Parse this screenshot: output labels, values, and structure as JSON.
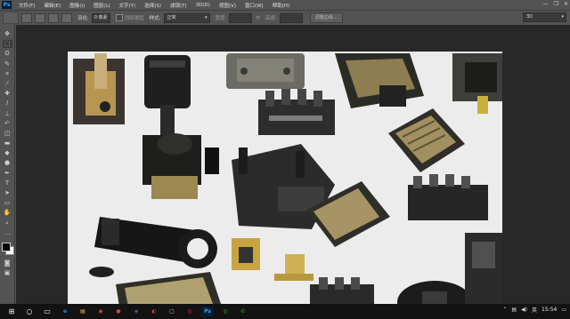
{
  "app": {
    "logo": "Ps"
  },
  "menu": {
    "items": [
      {
        "label": "文件(F)"
      },
      {
        "label": "编辑(E)"
      },
      {
        "label": "图像(I)"
      },
      {
        "label": "图层(L)"
      },
      {
        "label": "文字(Y)"
      },
      {
        "label": "选择(S)"
      },
      {
        "label": "滤镜(T)"
      },
      {
        "label": "3D(D)"
      },
      {
        "label": "视图(V)"
      },
      {
        "label": "窗口(W)"
      },
      {
        "label": "帮助(H)"
      }
    ],
    "window_controls": {
      "minimize": "—",
      "restore": "❐",
      "close": "✕"
    }
  },
  "options": {
    "feather_label": "羽化:",
    "feather_value": "0 像素",
    "antialias_label": "消除锯齿",
    "style_label": "样式:",
    "style_value": "正常",
    "width_label": "宽度:",
    "height_label": "高度:",
    "refine_edge_label": "调整边缘...",
    "workspace_value": "3D"
  },
  "tools": [
    {
      "icon": "move-icon",
      "glyph": "✥"
    },
    {
      "icon": "marquee-icon",
      "glyph": "⬚"
    },
    {
      "icon": "lasso-icon",
      "glyph": "ʘ"
    },
    {
      "icon": "quick-select-icon",
      "glyph": "✎"
    },
    {
      "icon": "crop-icon",
      "glyph": "⌗"
    },
    {
      "icon": "eyedropper-icon",
      "glyph": "⁄"
    },
    {
      "icon": "healing-icon",
      "glyph": "✚"
    },
    {
      "icon": "brush-icon",
      "glyph": "/"
    },
    {
      "icon": "stamp-icon",
      "glyph": "⊥"
    },
    {
      "icon": "history-brush-icon",
      "glyph": "↶"
    },
    {
      "icon": "eraser-icon",
      "glyph": "◫"
    },
    {
      "icon": "gradient-icon",
      "glyph": "▬"
    },
    {
      "icon": "blur-icon",
      "glyph": "◆"
    },
    {
      "icon": "dodge-icon",
      "glyph": "●"
    },
    {
      "icon": "pen-icon",
      "glyph": "✒"
    },
    {
      "icon": "type-icon",
      "glyph": "T"
    },
    {
      "icon": "path-select-icon",
      "glyph": "➤"
    },
    {
      "icon": "shape-icon",
      "glyph": "▭"
    },
    {
      "icon": "hand-icon",
      "glyph": "✋"
    },
    {
      "icon": "zoom-icon",
      "glyph": "⌕"
    },
    {
      "icon": "more-icon",
      "glyph": "…"
    }
  ],
  "bottom_tools": [
    {
      "icon": "quick-mask-icon",
      "glyph": "◙"
    },
    {
      "icon": "screen-mode-icon",
      "glyph": "▣"
    }
  ],
  "taskbar": {
    "start_glyph": "⊞",
    "search_glyph": "○",
    "taskview_glyph": "▭",
    "apps": [
      {
        "icon": "edge-icon",
        "glyph": "e",
        "color": "#1e90ff"
      },
      {
        "icon": "explorer-icon",
        "glyph": "▤",
        "color": "#f4c542"
      },
      {
        "icon": "app-icon-1",
        "glyph": "◉",
        "color": "#e34c26"
      },
      {
        "icon": "app-icon-2",
        "glyph": "●",
        "color": "#d04437"
      },
      {
        "icon": "app-icon-3",
        "glyph": "◈",
        "color": "#7a4fd8"
      },
      {
        "icon": "app-icon-4",
        "glyph": "◐",
        "color": "#e03a3a"
      },
      {
        "icon": "app-icon-5",
        "glyph": "▢",
        "color": "#cccccc"
      },
      {
        "icon": "app-icon-6",
        "glyph": "◍",
        "color": "#c2185b"
      },
      {
        "icon": "photoshop-taskbar-icon",
        "glyph": "Ps",
        "color": "#31a8ff"
      },
      {
        "icon": "app-icon-7",
        "glyph": "◎",
        "color": "#3cb043"
      },
      {
        "icon": "wechat-icon",
        "glyph": "✆",
        "color": "#2dc100"
      }
    ],
    "ime": "英",
    "clock": "15:54"
  },
  "colors": {
    "panel": "#535353",
    "canvas_bg": "#282828",
    "taskbar": "#121212",
    "accent": "#31a8ff"
  }
}
